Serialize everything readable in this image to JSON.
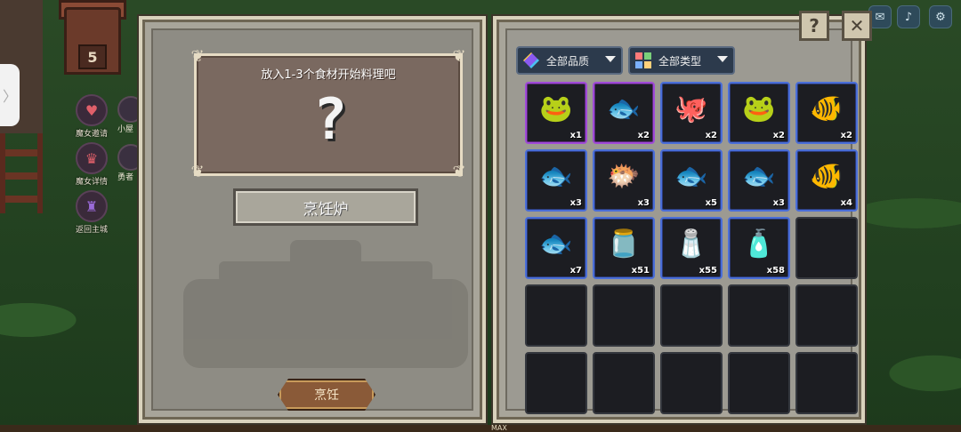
{
  "background": {
    "house_number": "5",
    "side_tab_glyph": "〉",
    "side_buttons": [
      {
        "label": "魔女邀请",
        "icon": "heart-mail-icon"
      },
      {
        "label": "魔女详情",
        "icon": "witch-portrait-icon"
      },
      {
        "label": "返回主城",
        "icon": "castle-icon"
      }
    ],
    "side_buttons_partial": [
      {
        "label": "小屋",
        "icon": "cabin-icon"
      },
      {
        "label": "勇者",
        "icon": "hero-icon"
      }
    ],
    "top_right_icons": [
      "mail-icon",
      "speaker-icon",
      "settings-icon"
    ]
  },
  "cooking_panel": {
    "prompt": "放入1-3个食材开始料理吧",
    "placeholder_glyph": "?",
    "stove_label": "烹饪炉",
    "cook_button": "烹饪"
  },
  "inventory_panel": {
    "help_glyph": "?",
    "close_glyph": "✕",
    "filters": [
      {
        "label": "全部品质",
        "icon": "quality-gem-icon"
      },
      {
        "label": "全部类型",
        "icon": "type-grid-icon"
      }
    ],
    "slots": [
      {
        "item": "green-frog",
        "glyph": "🐸",
        "count": "x1",
        "rarity": "purple"
      },
      {
        "item": "blue-fish",
        "glyph": "🐟",
        "count": "x2",
        "rarity": "purple"
      },
      {
        "item": "pink-octopus",
        "glyph": "🐙",
        "count": "x2",
        "rarity": "blue"
      },
      {
        "item": "green-frog",
        "glyph": "🐸",
        "count": "x2",
        "rarity": "blue"
      },
      {
        "item": "golden-fish",
        "glyph": "🐠",
        "count": "x2",
        "rarity": "blue"
      },
      {
        "item": "blue-fish",
        "glyph": "🐟",
        "count": "x3",
        "rarity": "blue"
      },
      {
        "item": "pufferfish",
        "glyph": "🐡",
        "count": "x3",
        "rarity": "blue"
      },
      {
        "item": "brown-fish",
        "glyph": "🐟",
        "count": "x5",
        "rarity": "blue"
      },
      {
        "item": "silver-fish",
        "glyph": "🐟",
        "count": "x3",
        "rarity": "blue"
      },
      {
        "item": "goldfish",
        "glyph": "🐠",
        "count": "x4",
        "rarity": "blue"
      },
      {
        "item": "grey-fish",
        "glyph": "🐟",
        "count": "x7",
        "rarity": "blue"
      },
      {
        "item": "milk-jar",
        "glyph": "🫙",
        "count": "x51",
        "rarity": "blue"
      },
      {
        "item": "salt-pouch",
        "glyph": "🧂",
        "count": "x55",
        "rarity": "blue"
      },
      {
        "item": "oil-bottle",
        "glyph": "🧴",
        "count": "x58",
        "rarity": "blue"
      },
      {
        "item": "",
        "glyph": "",
        "count": "",
        "rarity": "none"
      },
      {
        "item": "",
        "glyph": "",
        "count": "",
        "rarity": "none"
      },
      {
        "item": "",
        "glyph": "",
        "count": "",
        "rarity": "none"
      },
      {
        "item": "",
        "glyph": "",
        "count": "",
        "rarity": "none"
      },
      {
        "item": "",
        "glyph": "",
        "count": "",
        "rarity": "none"
      },
      {
        "item": "",
        "glyph": "",
        "count": "",
        "rarity": "none"
      },
      {
        "item": "",
        "glyph": "",
        "count": "",
        "rarity": "none"
      },
      {
        "item": "",
        "glyph": "",
        "count": "",
        "rarity": "none"
      },
      {
        "item": "",
        "glyph": "",
        "count": "",
        "rarity": "none"
      },
      {
        "item": "",
        "glyph": "",
        "count": "",
        "rarity": "none"
      },
      {
        "item": "",
        "glyph": "",
        "count": "",
        "rarity": "none"
      }
    ]
  },
  "footer": {
    "max_label": "MAX"
  }
}
